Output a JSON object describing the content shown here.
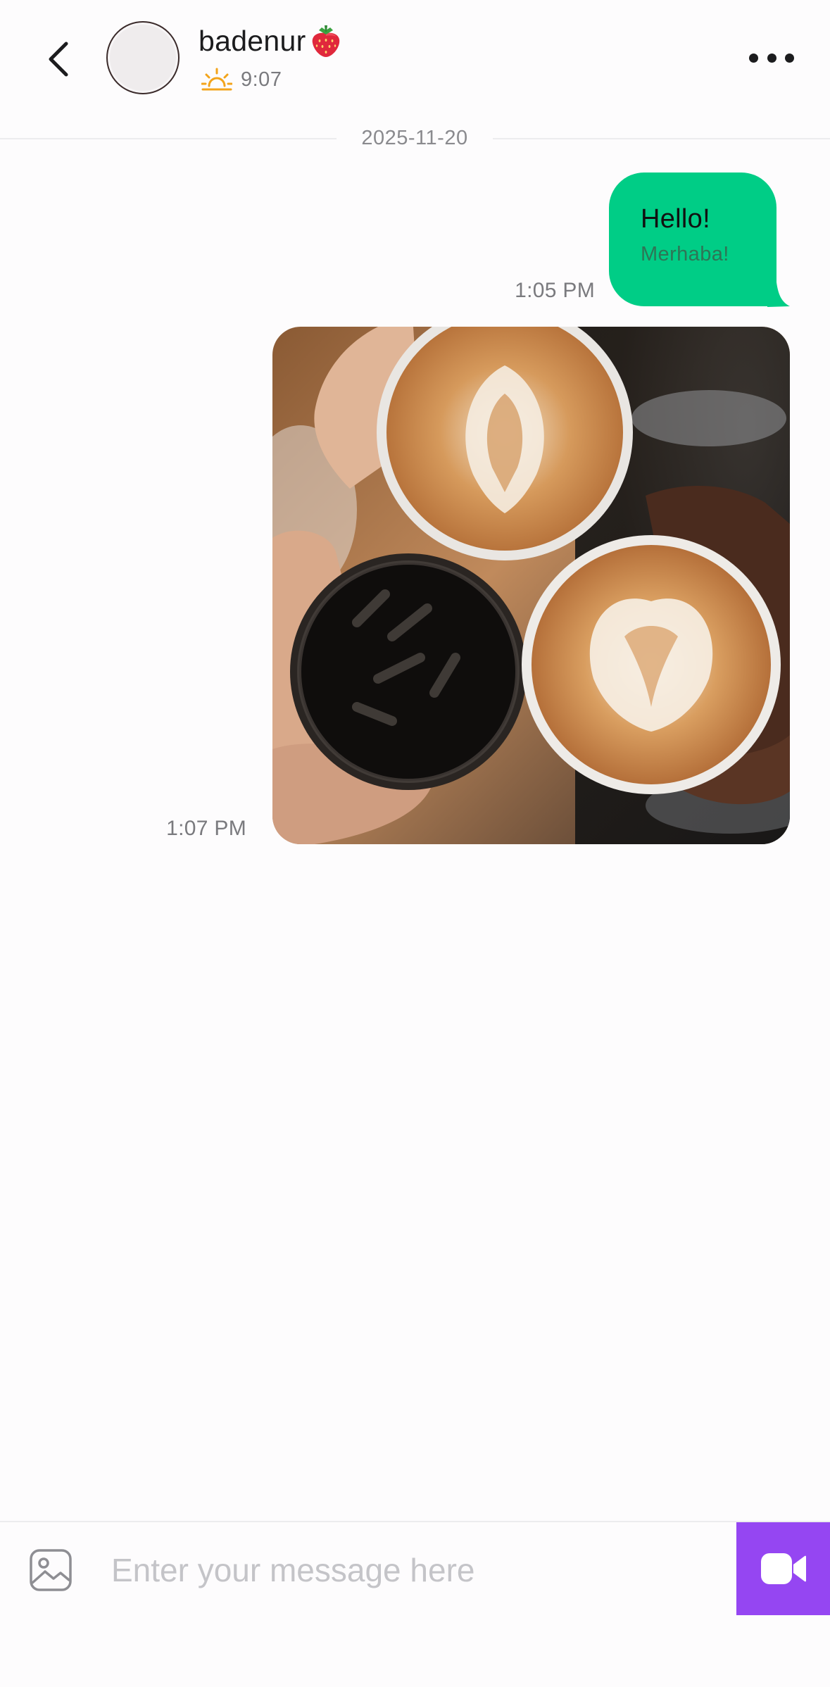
{
  "header": {
    "username": "badenur",
    "name_emoji": "strawberry-icon",
    "status_icon": "sunrise-icon",
    "local_time": "9:07"
  },
  "chat": {
    "date_separator": "2025-11-20",
    "messages": [
      {
        "type": "text",
        "direction": "outgoing",
        "text": "Hello!",
        "translation": "Merhaba!",
        "time": "1:05 PM"
      },
      {
        "type": "image",
        "direction": "outgoing",
        "image_subject": "coffee-cheers-photo",
        "time": "1:07 PM"
      }
    ]
  },
  "composer": {
    "placeholder": "Enter your message here",
    "value": ""
  },
  "colors": {
    "bubble_accent": "#00cd86",
    "video_button": "#9546f2",
    "status_icon": "#f3a41b"
  }
}
